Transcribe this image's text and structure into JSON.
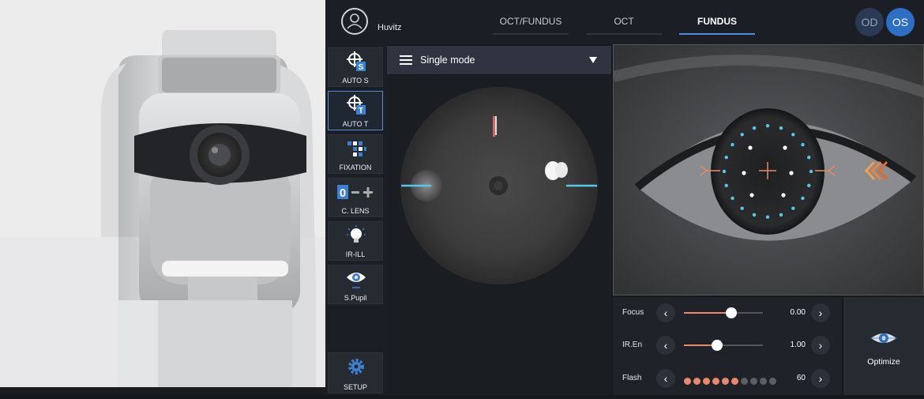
{
  "header": {
    "user_name": "Huvitz",
    "tabs": [
      {
        "label": "OCT/FUNDUS",
        "active": false
      },
      {
        "label": "OCT",
        "active": false
      },
      {
        "label": "FUNDUS",
        "active": true
      }
    ],
    "eye_buttons": [
      {
        "label": "OD",
        "active": false
      },
      {
        "label": "OS",
        "active": true
      }
    ]
  },
  "sidebar": {
    "items": [
      {
        "label": "AUTO S",
        "icon": "target-s-icon",
        "active": false
      },
      {
        "label": "AUTO T",
        "icon": "target-t-icon",
        "active": true
      },
      {
        "label": "FIXATION",
        "icon": "fixation-grid-icon",
        "active": false
      },
      {
        "label": "C. LENS",
        "icon": "lens-compensation-icon",
        "active": false
      },
      {
        "label": "IR-ILL",
        "icon": "lightbulb-icon",
        "active": false
      },
      {
        "label": "S.Pupil",
        "icon": "pupil-eye-icon",
        "active": false
      }
    ],
    "setup_label": "SETUP"
  },
  "mode": {
    "label": "Single mode"
  },
  "controls": {
    "focus": {
      "label": "Focus",
      "value": "0.00",
      "level": 0.6
    },
    "ir_en": {
      "label": "IR.En",
      "value": "1.00",
      "level": 0.42
    },
    "flash": {
      "label": "Flash",
      "value": "60",
      "active_dots": 6,
      "total_dots": 10
    }
  },
  "optimize_label": "Optimize",
  "colors": {
    "accent_blue": "#4c8fd9",
    "accent_orange": "#e8896a",
    "cyan_marker": "#56c8e8",
    "os_button": "#2d6fc4",
    "od_button": "#2a3a55"
  }
}
